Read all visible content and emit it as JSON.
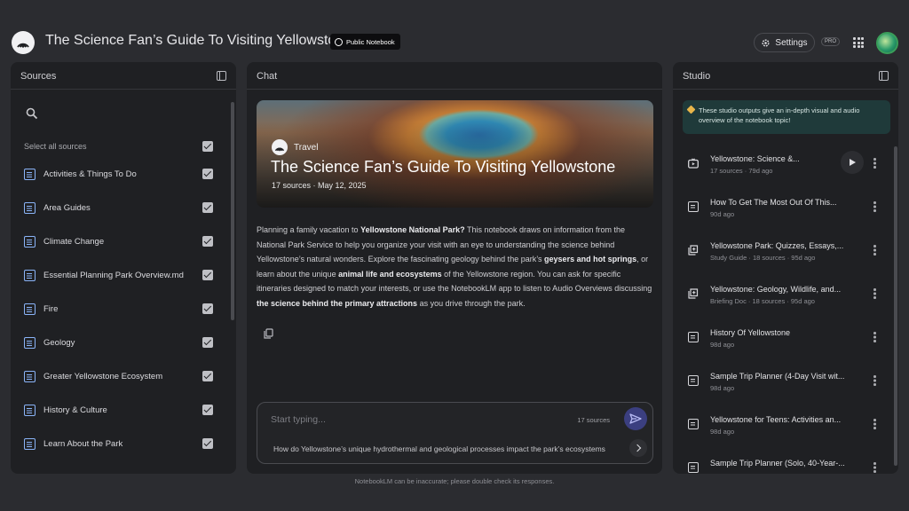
{
  "header": {
    "title": "The Science Fan’s Guide To Visiting Yellowstone",
    "badge": "Public Notebook",
    "settings_label": "Settings",
    "pro_label": "PRO"
  },
  "sources": {
    "title": "Sources",
    "select_all": "Select all sources",
    "items": [
      {
        "label": "Activities & Things To Do",
        "checked": true
      },
      {
        "label": "Area Guides",
        "checked": true
      },
      {
        "label": "Climate Change",
        "checked": true
      },
      {
        "label": "Essential Planning Park Overview.md",
        "checked": true
      },
      {
        "label": "Fire",
        "checked": true
      },
      {
        "label": "Geology",
        "checked": true
      },
      {
        "label": "Greater Yellowstone Ecosystem",
        "checked": true
      },
      {
        "label": "History & Culture",
        "checked": true
      },
      {
        "label": "Learn About the Park",
        "checked": true
      }
    ]
  },
  "chat": {
    "title": "Chat",
    "hero": {
      "category": "Travel",
      "title": "The Science Fan’s Guide To Visiting Yellowstone",
      "meta": "17 sources · May 12, 2025"
    },
    "summary": {
      "p1": "Planning a family vacation to ",
      "b1": "Yellowstone National Park?",
      "p2": " This notebook draws on information from the National Park Service to help you organize your visit with an eye to understanding the science behind Yellowstone’s natural wonders. Explore the fascinating geology behind the park’s ",
      "b2": "geysers and hot springs",
      "p3": ", or learn about the unique ",
      "b3": "animal life and ecosystems",
      "p4": " of the Yellowstone region. You can ask for specific itineraries designed to match your interests, or use the NotebookLM app to listen to Audio Overviews discussing ",
      "b4": "the science behind the primary attractions",
      "p5": " as you drive through the park."
    },
    "input_placeholder": "Start typing...",
    "source_count": "17 sources",
    "suggestion": "How do Yellowstone’s unique hydrothermal and geological processes impact the park’s ecosystems"
  },
  "studio": {
    "title": "Studio",
    "note": "These studio outputs give an in-depth visual and audio overview of the notebook topic!",
    "items": [
      {
        "title": "Yellowstone: Science &...",
        "meta": "17 sources · 79d ago",
        "icon": "audio-overview-icon"
      },
      {
        "title": "How To Get The Most Out Of This...",
        "meta": "90d ago",
        "icon": "note-icon"
      },
      {
        "title": "Yellowstone Park: Quizzes, Essays,...",
        "meta": "Study Guide · 18 sources · 95d ago",
        "icon": "study-guide-icon"
      },
      {
        "title": "Yellowstone: Geology, Wildlife, and...",
        "meta": "Briefing Doc · 18 sources · 95d ago",
        "icon": "briefing-doc-icon"
      },
      {
        "title": "History Of Yellowstone",
        "meta": "98d ago",
        "icon": "note-icon"
      },
      {
        "title": "Sample Trip Planner (4-Day Visit wit...",
        "meta": "98d ago",
        "icon": "note-icon"
      },
      {
        "title": "Yellowstone for Teens: Activities an...",
        "meta": "98d ago",
        "icon": "note-icon"
      },
      {
        "title": "Sample Trip Planner (Solo, 40-Year-...",
        "meta": "",
        "icon": "note-icon"
      }
    ]
  },
  "footer": "NotebookLM can be inaccurate; please double check its responses."
}
